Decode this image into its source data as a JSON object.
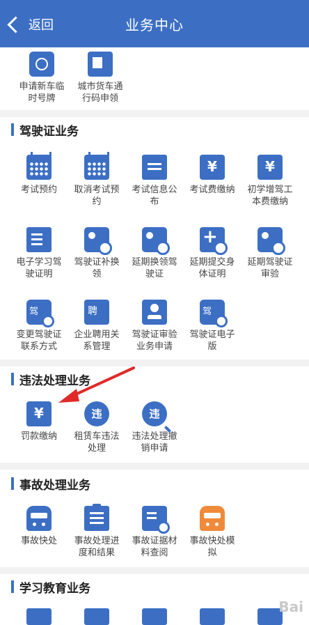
{
  "header": {
    "back_label": "返回",
    "title": "业务中心"
  },
  "top_items": [
    {
      "label": "申请新车临时号牌",
      "icon": "plate-icon"
    },
    {
      "label": "城市货车通行码申领",
      "icon": "truck-icon"
    }
  ],
  "sections": [
    {
      "title": "驾驶证业务",
      "items": [
        {
          "label": "考试预约",
          "icon": "calendar-icon"
        },
        {
          "label": "取消考试预约",
          "icon": "calendar-icon"
        },
        {
          "label": "考试信息公布",
          "icon": "board-icon"
        },
        {
          "label": "考试费缴纳",
          "icon": "receipt-yen-icon"
        },
        {
          "label": "初学增驾工本费缴纳",
          "icon": "yen-list-icon"
        },
        {
          "label": "电子学习驾驶证明",
          "icon": "document-user-icon"
        },
        {
          "label": "驾驶证补换领",
          "icon": "license-refresh-icon"
        },
        {
          "label": "延期换领驾驶证",
          "icon": "license-clock-icon"
        },
        {
          "label": "延期提交身体证明",
          "icon": "medical-clock-icon"
        },
        {
          "label": "延期驾驶证审验",
          "icon": "license-check-icon"
        },
        {
          "label": "变更驾驶证联系方式",
          "icon": "license-phone-icon"
        },
        {
          "label": "企业聘用关系管理",
          "icon": "employ-doc-icon"
        },
        {
          "label": "驾驶证审验业务申请",
          "icon": "badge-icon"
        },
        {
          "label": "驾驶证电子版",
          "icon": "e-license-icon"
        }
      ]
    },
    {
      "title": "违法处理业务",
      "items": [
        {
          "label": "罚款缴纳",
          "icon": "fine-receipt-icon"
        },
        {
          "label": "租赁车违法处理",
          "icon": "violation-hand-icon"
        },
        {
          "label": "违法处理撤销申请",
          "icon": "violation-search-icon"
        }
      ]
    },
    {
      "title": "事故处理业务",
      "items": [
        {
          "label": "事故快处",
          "icon": "car-crash-icon"
        },
        {
          "label": "事故处理进度和结果",
          "icon": "clipboard-icon"
        },
        {
          "label": "事故证据材料查阅",
          "icon": "document-search-icon"
        },
        {
          "label": "事故快处模拟",
          "icon": "car-crash-orange-icon"
        }
      ]
    },
    {
      "title": "学习教育业务",
      "items": []
    }
  ],
  "colors": {
    "primary": "#3c6fc4",
    "accent_orange": "#ee8a3a",
    "arrow": "#e02a2a"
  },
  "watermark": "Bai"
}
